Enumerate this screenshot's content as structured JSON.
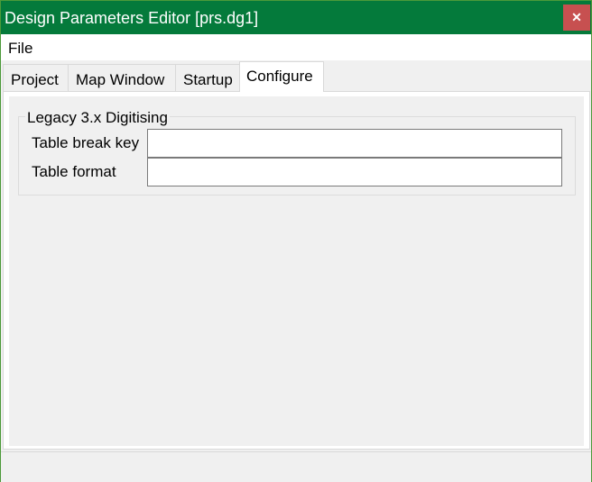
{
  "window": {
    "title": "Design Parameters Editor [prs.dg1]",
    "close_icon": "close-icon"
  },
  "menu": {
    "file": "File"
  },
  "tabs": [
    {
      "label": "Project"
    },
    {
      "label": "Map Window"
    },
    {
      "label": "Startup"
    },
    {
      "label": "Configure",
      "active": true
    }
  ],
  "group": {
    "title": "Legacy 3.x Digitising",
    "fields": [
      {
        "label": "Table break key",
        "value": ""
      },
      {
        "label": "Table format",
        "value": ""
      }
    ]
  }
}
